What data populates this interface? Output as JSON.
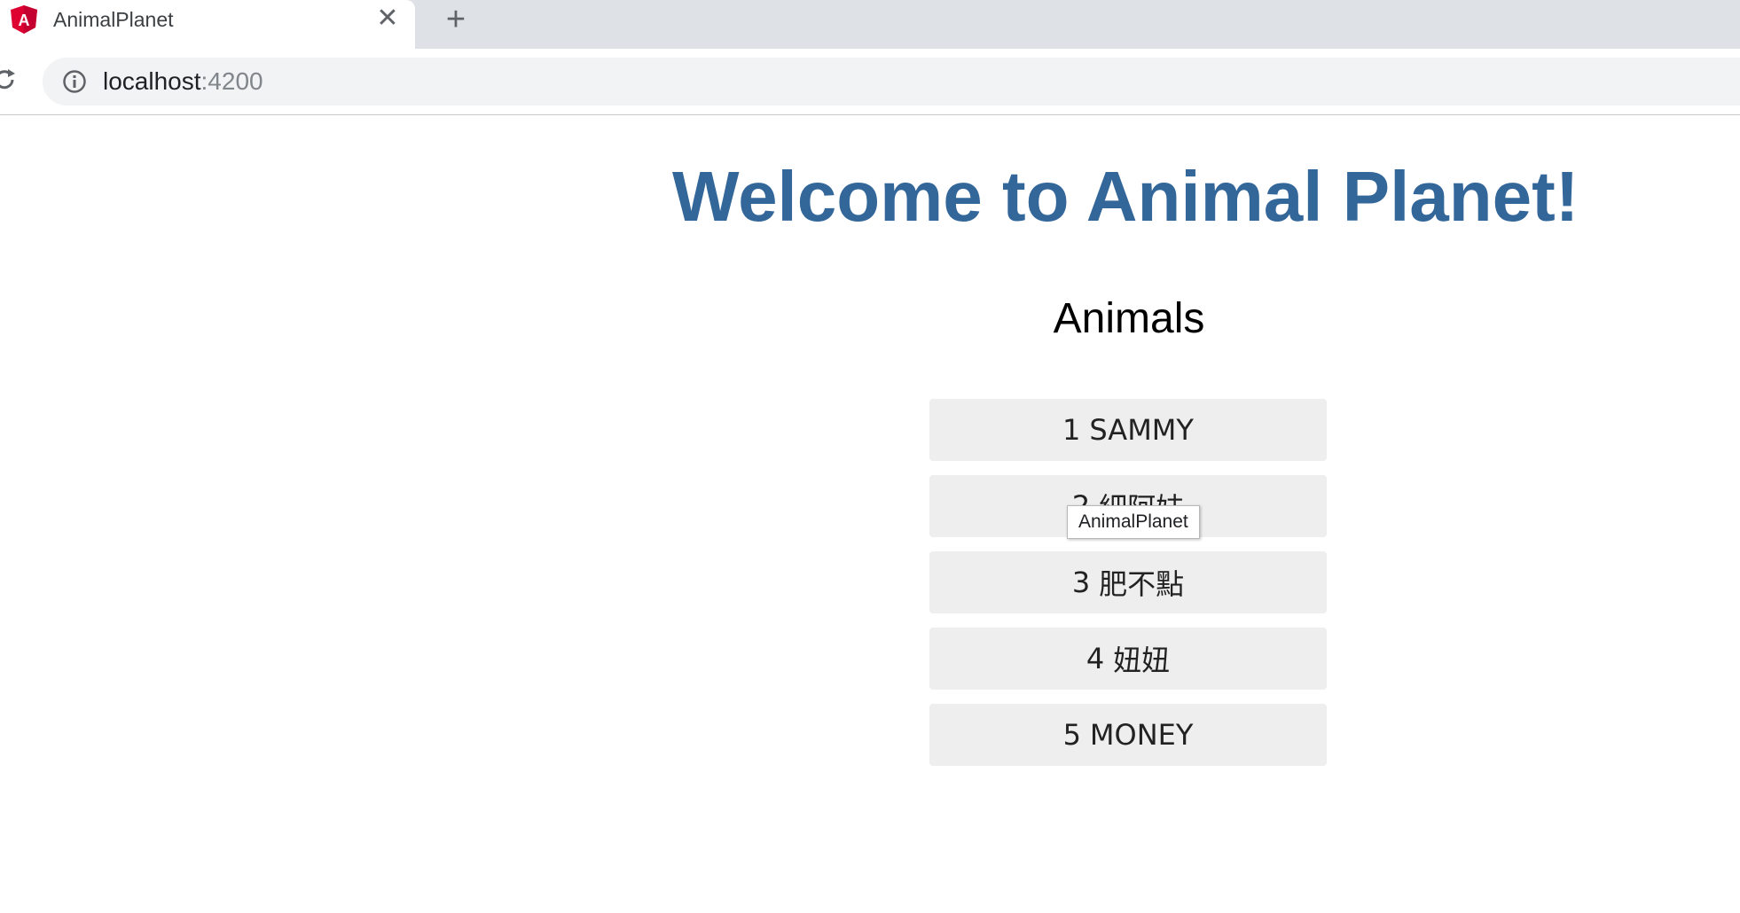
{
  "browser": {
    "tab_title": "AnimalPlanet",
    "favicon_icon": "angular-logo-icon",
    "favicon_letter": "A",
    "close_icon": "close-icon",
    "new_tab_icon": "plus-icon",
    "reload_icon": "reload-icon",
    "info_icon": "info-icon",
    "url_host": "localhost",
    "url_port": ":4200"
  },
  "page": {
    "title": "Welcome to Animal Planet!",
    "title_color": "#336699",
    "section_title": "Animals",
    "animals": [
      {
        "id": "1",
        "name": "SAMMY"
      },
      {
        "id": "2",
        "name": "細阿妹"
      },
      {
        "id": "3",
        "name": "肥不點"
      },
      {
        "id": "4",
        "name": "妞妞"
      },
      {
        "id": "5",
        "name": "MONEY"
      }
    ]
  },
  "tooltip": {
    "text": "AnimalPlanet"
  }
}
